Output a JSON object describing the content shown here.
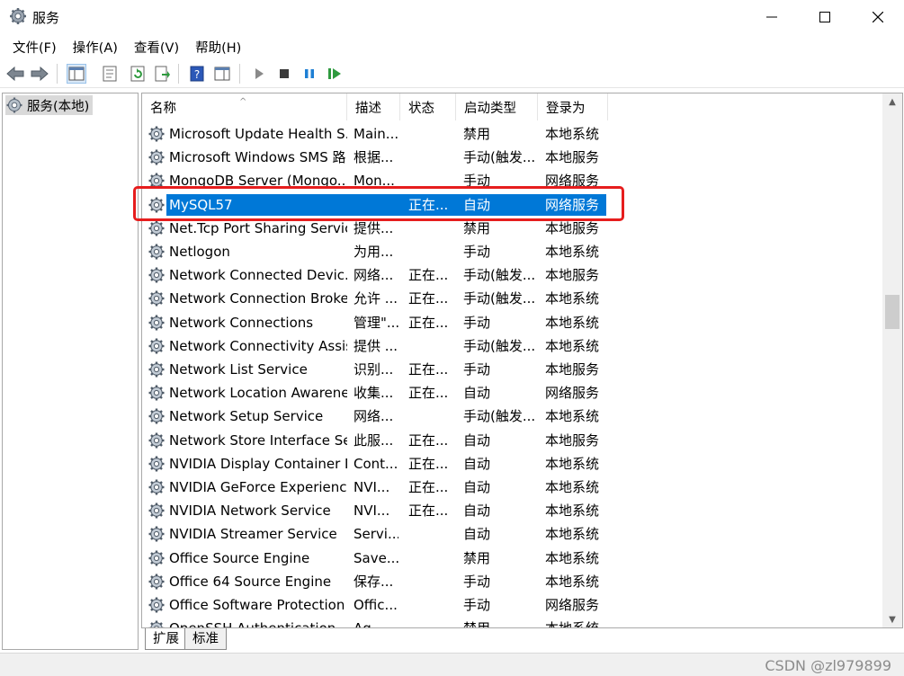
{
  "window": {
    "title": "服务",
    "icon": "gear-icon"
  },
  "menu": [
    "文件(F)",
    "操作(A)",
    "查看(V)",
    "帮助(H)"
  ],
  "tree": {
    "label": "服务(本地)"
  },
  "columns": [
    "名称",
    "描述",
    "状态",
    "启动类型",
    "登录为"
  ],
  "services": [
    {
      "name": "Microsoft Update Health S...",
      "desc": "Main...",
      "status": "",
      "start": "禁用",
      "logon": "本地系统"
    },
    {
      "name": "Microsoft Windows SMS 路...",
      "desc": "根据...",
      "status": "",
      "start": "手动(触发...",
      "logon": "本地服务"
    },
    {
      "name": "MongoDB Server (Mongo...",
      "desc": "Mon...",
      "status": "",
      "start": "手动",
      "logon": "网络服务"
    },
    {
      "name": "MySQL57",
      "desc": "",
      "status": "正在...",
      "start": "自动",
      "logon": "网络服务",
      "selected": true
    },
    {
      "name": "Net.Tcp Port Sharing Service",
      "desc": "提供...",
      "status": "",
      "start": "禁用",
      "logon": "本地服务"
    },
    {
      "name": "Netlogon",
      "desc": "为用...",
      "status": "",
      "start": "手动",
      "logon": "本地系统"
    },
    {
      "name": "Network Connected Devic...",
      "desc": "网络...",
      "status": "正在...",
      "start": "手动(触发...",
      "logon": "本地服务"
    },
    {
      "name": "Network Connection Broker",
      "desc": "允许 ...",
      "status": "正在...",
      "start": "手动(触发...",
      "logon": "本地系统"
    },
    {
      "name": "Network Connections",
      "desc": "管理\"...",
      "status": "正在...",
      "start": "手动",
      "logon": "本地系统"
    },
    {
      "name": "Network Connectivity Assis...",
      "desc": "提供 ...",
      "status": "",
      "start": "手动(触发...",
      "logon": "本地系统"
    },
    {
      "name": "Network List Service",
      "desc": "识别...",
      "status": "正在...",
      "start": "手动",
      "logon": "本地服务"
    },
    {
      "name": "Network Location Awarene...",
      "desc": "收集...",
      "status": "正在...",
      "start": "自动",
      "logon": "网络服务"
    },
    {
      "name": "Network Setup Service",
      "desc": "网络...",
      "status": "",
      "start": "手动(触发...",
      "logon": "本地系统"
    },
    {
      "name": "Network Store Interface Se...",
      "desc": "此服...",
      "status": "正在...",
      "start": "自动",
      "logon": "本地服务"
    },
    {
      "name": "NVIDIA Display Container LS",
      "desc": "Cont...",
      "status": "正在...",
      "start": "自动",
      "logon": "本地系统"
    },
    {
      "name": "NVIDIA GeForce Experienc...",
      "desc": "NVI...",
      "status": "正在...",
      "start": "自动",
      "logon": "本地系统"
    },
    {
      "name": "NVIDIA Network Service",
      "desc": "NVI...",
      "status": "正在...",
      "start": "自动",
      "logon": "本地系统"
    },
    {
      "name": "NVIDIA Streamer Service",
      "desc": "Servi...",
      "status": "",
      "start": "自动",
      "logon": "本地系统"
    },
    {
      "name": "Office  Source Engine",
      "desc": "Save...",
      "status": "",
      "start": "禁用",
      "logon": "本地系统"
    },
    {
      "name": "Office 64 Source Engine",
      "desc": "保存...",
      "status": "",
      "start": "手动",
      "logon": "本地系统"
    },
    {
      "name": "Office Software Protection ...",
      "desc": "Offic...",
      "status": "",
      "start": "手动",
      "logon": "网络服务"
    },
    {
      "name": "OpenSSH Authentication ...",
      "desc": "Ag...",
      "status": "",
      "start": "禁用",
      "logon": "本地系统"
    }
  ],
  "tabs": [
    "扩展",
    "标准"
  ],
  "watermark": "CSDN @zl979899",
  "colors": {
    "selection": "#0078d7",
    "highlight": "#e61d1d"
  }
}
